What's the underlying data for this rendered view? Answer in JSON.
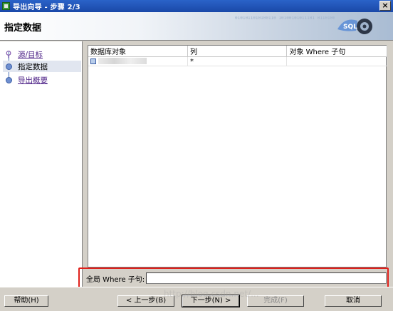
{
  "window": {
    "title": "导出向导 - 步骤 2/3",
    "close_glyph": "×"
  },
  "banner": {
    "heading": "指定数据",
    "binary_text": "0101011010100110 10100101011101 0110100110101010 1011010011",
    "logo_text": "SQL"
  },
  "sidebar": {
    "steps": [
      {
        "label": "源/目标",
        "icon": "person-icon",
        "state": "link"
      },
      {
        "label": "指定数据",
        "icon": "step-dot-icon",
        "state": "active"
      },
      {
        "label": "导出概要",
        "icon": "step-dot-icon",
        "state": "link"
      }
    ]
  },
  "grid": {
    "columns": [
      "数据库对象",
      "列",
      "对象 Where 子句"
    ],
    "rows": [
      {
        "object": "",
        "columns": "*",
        "where": ""
      }
    ]
  },
  "global_where": {
    "label": "全局 Where 子句:",
    "value": ""
  },
  "buttons": {
    "help": "帮助(H)",
    "back": "< 上一步(B)",
    "next": "下一步(N) >",
    "finish": "完成(F)",
    "cancel": "取消"
  },
  "watermark": "http://blog.csdn.net/..."
}
